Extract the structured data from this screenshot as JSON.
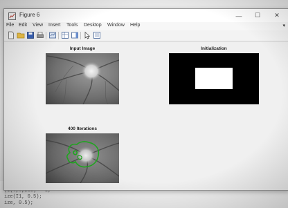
{
  "window": {
    "title": "Figure 6",
    "controls": {
      "minimize": "—",
      "maximize": "☐",
      "close": "✕"
    }
  },
  "menu": {
    "items": [
      "File",
      "Edit",
      "View",
      "Insert",
      "Tools",
      "Desktop",
      "Window",
      "Help"
    ],
    "overflow_arrow": "▾"
  },
  "toolbar": {
    "buttons": [
      "new-figure-icon",
      "open-file-icon",
      "save-icon",
      "print-icon",
      "edit-plot-icon",
      "link-plot-icon",
      "insert-colorbar-icon",
      "pointer-icon",
      "insert-legend-icon"
    ]
  },
  "axes": {
    "input_title": "Input Image",
    "init_title": "Initialization",
    "result_title": "400 Iterations"
  },
  "colors": {
    "contour": "#1fa51f",
    "mask_background": "#000000",
    "mask_foreground": "#ffffff"
  },
  "console": {
    "lines": [
      "(I(:,:,250) = 1;",
      "ize(I1, 0.5);",
      "ize, 0.5);"
    ]
  }
}
